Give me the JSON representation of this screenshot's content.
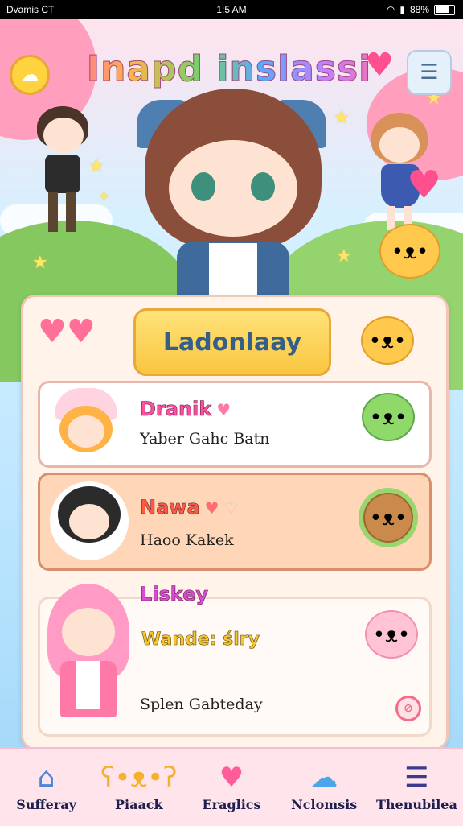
{
  "status_bar": {
    "carrier": "Dvamis CT",
    "time": "1:5 AM",
    "battery": "88%"
  },
  "header": {
    "title": "Inapd inslassi"
  },
  "leaderboard": {
    "button_label": "Ladonlaay"
  },
  "entries": [
    {
      "name": "Dranik",
      "subtitle": "Yaber Gahc Batn",
      "name_color": "#ff4fa3"
    },
    {
      "name": "Nawa",
      "subtitle": "Haoo Kakek",
      "name_color": "#ff5a3b"
    },
    {
      "name": "Liskey",
      "subtitle": "Splen Gabteday",
      "extra": "Wande: ślry",
      "name_color": "#d64bd3"
    }
  ],
  "nav": [
    {
      "label": "Sufferay",
      "icon": "house-icon",
      "color": "#4b86d8"
    },
    {
      "label": "Piaack",
      "icon": "bear-icon",
      "color": "#f5b02e"
    },
    {
      "label": "Eraglics",
      "icon": "heart-icon",
      "color": "#ff5c99"
    },
    {
      "label": "Nclomsis",
      "icon": "chat-icon",
      "color": "#4aa6e8"
    },
    {
      "label": "Thenubilea",
      "icon": "list-icon",
      "color": "#3b3b8a"
    }
  ]
}
